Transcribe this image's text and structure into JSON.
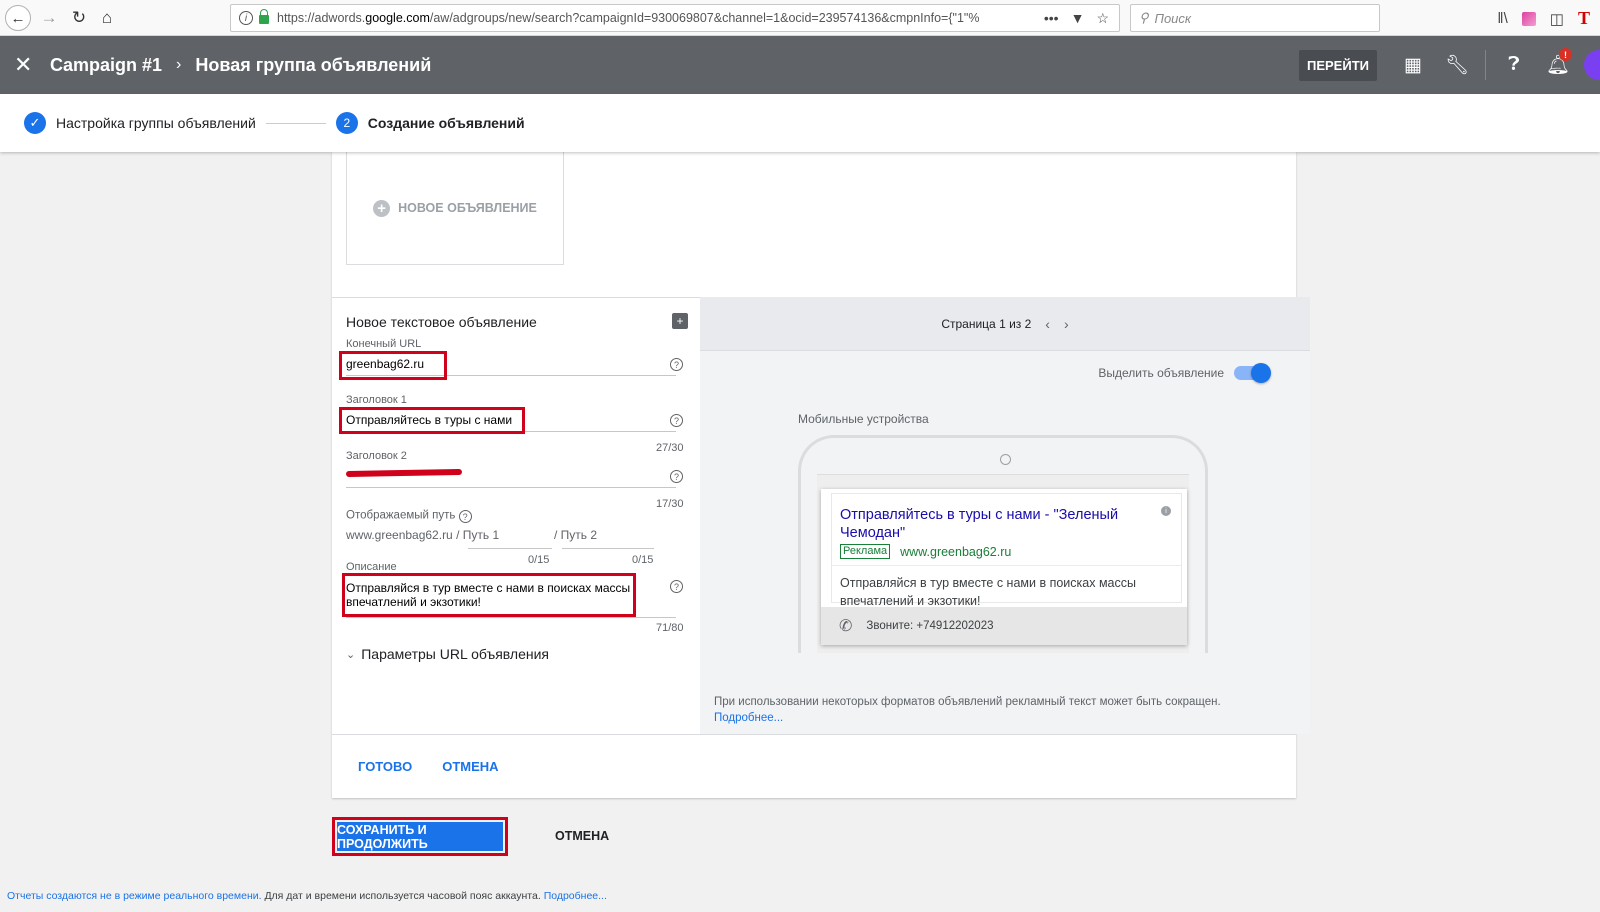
{
  "browser": {
    "url_prefix": "https://adwords.",
    "url_domain": "google.com",
    "url_rest": "/aw/adgroups/new/search?campaignId=930069807&channel=1&ocid=239574136&cmpnInfo={\"1\"%",
    "search_placeholder": "Поиск"
  },
  "header": {
    "campaign": "Campaign #1",
    "title": "Новая группа объявлений",
    "goto_label": "ПЕРЕЙТИ",
    "bell_badge": "!"
  },
  "stepper": {
    "step1_label": "Настройка группы объявлений",
    "step2_number": "2",
    "step2_label": "Создание объявлений"
  },
  "new_ad_tile": {
    "label": "НОВОЕ ОБЪЯВЛЕНИЕ"
  },
  "editor": {
    "title": "Новое текстовое объявление",
    "final_url_label": "Конечный URL",
    "final_url_value": "greenbag62.ru",
    "headline1_label": "Заголовок 1",
    "headline1_value": "Отправляйтесь в туры с нами",
    "headline1_counter": "27/30",
    "headline2_label": "Заголовок 2",
    "headline2_counter": "17/30",
    "display_path_label": "Отображаемый путь",
    "display_path_base": "www.greenbag62.ru / Путь 1",
    "path2": "/ Путь 2",
    "path1_counter": "0/15",
    "path2_counter": "0/15",
    "description_label": "Описание",
    "description_value": "Отправляйся в тур вместе с нами в поисках массы впечатлений и экзотики!",
    "description_counter": "71/80",
    "url_params_label": "Параметры URL объявления"
  },
  "preview": {
    "page_label": "Страница 1 из 2",
    "highlight_label": "Выделить объявление",
    "highlight_on": true,
    "mobile_label": "Мобильные устройства",
    "ad_title": "Отправляйтесь в туры с нами - \"Зеленый Чемодан\"",
    "ad_badge": "Реклама",
    "ad_url": "www.greenbag62.ru",
    "ad_description": "Отправляйся в тур вместе с нами в поисках массы впечатлений и экзотики!",
    "ad_call": "Звоните: +74912202023",
    "note": "При использовании некоторых форматов объявлений рекламный текст может быть сокращен.",
    "note_link": "Подробнее..."
  },
  "card_actions": {
    "done_label": "ГОТОВО",
    "cancel_label": "ОТМЕНА"
  },
  "page_actions": {
    "save_label": "СОХРАНИТЬ И ПРОДОЛЖИТЬ",
    "cancel_label": "ОТМЕНА"
  },
  "footer": {
    "link1": "Отчеты создаются не в режиме реального времени.",
    "text": " Для дат и времени используется часовой пояс аккаунта. ",
    "link2": "Подробнее..."
  },
  "colors": {
    "accent": "#1a73e8",
    "header_bg": "#5f6368",
    "highlight_red": "#d0021b",
    "ad_green": "#188038",
    "ad_title_blue": "#1a0dab"
  }
}
